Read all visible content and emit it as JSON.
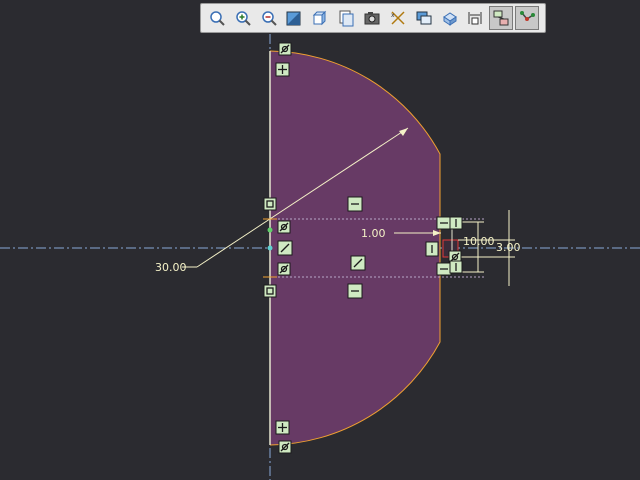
{
  "toolbar": {
    "buttons": [
      {
        "name": "zoom-fit",
        "icon": "zoom-fit-icon"
      },
      {
        "name": "zoom-in",
        "icon": "zoom-in-icon"
      },
      {
        "name": "zoom-out",
        "icon": "zoom-out-icon"
      },
      {
        "name": "shading",
        "icon": "shading-icon"
      },
      {
        "name": "view-orientation",
        "icon": "cube-icon"
      },
      {
        "name": "saved-views",
        "icon": "saved-views-icon"
      },
      {
        "name": "capture",
        "icon": "camera-icon"
      },
      {
        "name": "datum-display",
        "icon": "datum-display-icon"
      },
      {
        "name": "layers",
        "icon": "layers-icon"
      },
      {
        "name": "display-style",
        "icon": "display-style-icon"
      },
      {
        "name": "dimension-display",
        "icon": "dimension-display-icon"
      },
      {
        "name": "constraint-display",
        "icon": "constraint-display-icon",
        "active": true
      },
      {
        "name": "vertex-display",
        "icon": "vertex-display-icon",
        "active": true
      }
    ]
  },
  "sketch": {
    "dimensions": {
      "radius": "30.00",
      "offset": "1.00",
      "width": "10.00",
      "height": "3.00"
    },
    "colors": {
      "background": "#2b2b30",
      "fill": "#673a65",
      "outline": "#f0a030",
      "dimension": "#f4f1c7",
      "centerline": "#8aa9d8",
      "constraint": "#cfe9c2"
    }
  }
}
